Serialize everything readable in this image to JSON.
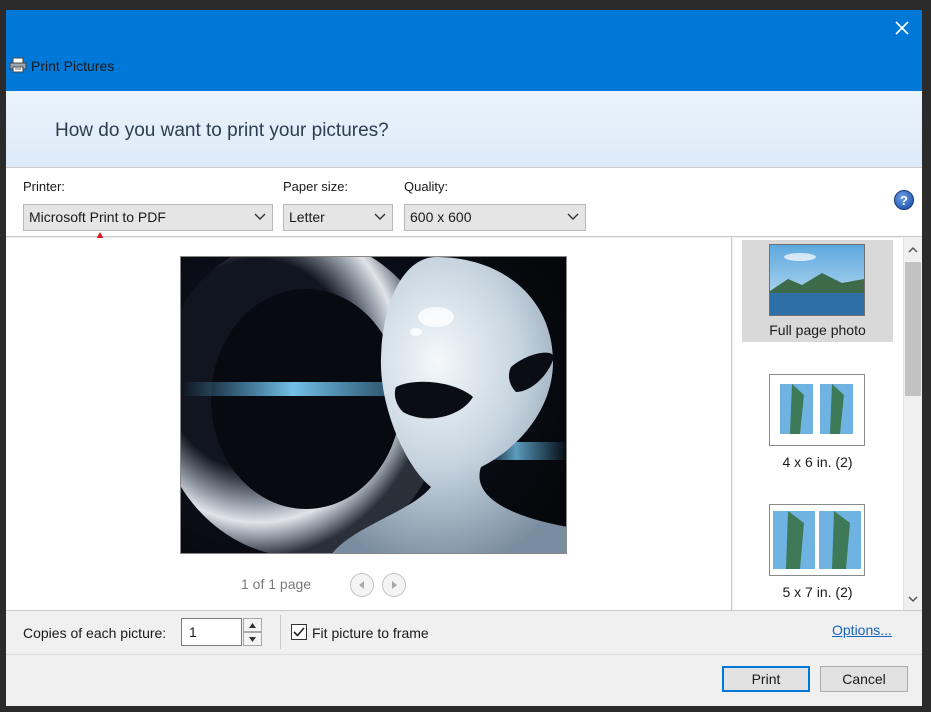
{
  "window": {
    "title": "Print Pictures",
    "close_icon": "close-icon"
  },
  "header": {
    "question": "How do you want to print your pictures?"
  },
  "options": {
    "printer_label": "Printer:",
    "printer_value": "Microsoft Print to PDF",
    "paper_size_label": "Paper size:",
    "paper_size_value": "Letter",
    "quality_label": "Quality:",
    "quality_value": "600 x 600",
    "help_icon": "help-icon"
  },
  "annotation": {
    "arrow_icon": "red-arrow-up-icon",
    "color": "#e8101a"
  },
  "preview": {
    "page_indicator": "1 of 1 page",
    "prev_icon": "arrow-left-icon",
    "next_icon": "arrow-right-icon"
  },
  "layouts": {
    "items": [
      {
        "label": "Full page photo",
        "selected": true
      },
      {
        "label": "4 x 6 in. (2)",
        "selected": false
      },
      {
        "label": "5 x 7 in. (2)",
        "selected": false
      }
    ]
  },
  "copies": {
    "label": "Copies of each picture:",
    "value": "1"
  },
  "fit": {
    "label": "Fit picture to frame",
    "checked": true
  },
  "options_link": "Options...",
  "buttons": {
    "print": "Print",
    "cancel": "Cancel"
  },
  "colors": {
    "titlebar": "#0078d7",
    "link": "#1564c0"
  }
}
